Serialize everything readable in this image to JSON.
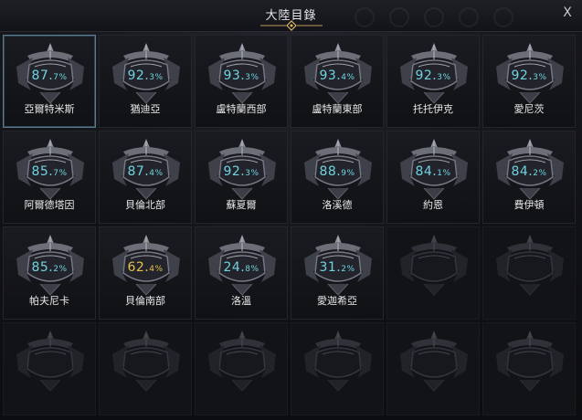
{
  "window": {
    "title": "大陸目錄",
    "close_label": "X"
  },
  "regions": [
    {
      "name": "亞爾特米斯",
      "pct": "87.",
      "dec": "7%",
      "active": true,
      "color": "cyan"
    },
    {
      "name": "猶迪亞",
      "pct": "92.",
      "dec": "3%",
      "active": false,
      "color": "cyan"
    },
    {
      "name": "盧特蘭西部",
      "pct": "93.",
      "dec": "3%",
      "active": false,
      "color": "cyan"
    },
    {
      "name": "盧特蘭東部",
      "pct": "93.",
      "dec": "4%",
      "active": false,
      "color": "cyan"
    },
    {
      "name": "托托伊克",
      "pct": "92.",
      "dec": "3%",
      "active": false,
      "color": "cyan"
    },
    {
      "name": "愛尼茨",
      "pct": "92.",
      "dec": "3%",
      "active": false,
      "color": "cyan"
    },
    {
      "name": "阿爾德塔因",
      "pct": "85.",
      "dec": "7%",
      "active": false,
      "color": "cyan"
    },
    {
      "name": "貝倫北部",
      "pct": "87.",
      "dec": "4%",
      "active": false,
      "color": "cyan"
    },
    {
      "name": "蘇夏爾",
      "pct": "92.",
      "dec": "3%",
      "active": false,
      "color": "cyan"
    },
    {
      "name": "洛溪德",
      "pct": "88.",
      "dec": "9%",
      "active": false,
      "color": "cyan"
    },
    {
      "name": "約恩",
      "pct": "84.",
      "dec": "1%",
      "active": false,
      "color": "cyan"
    },
    {
      "name": "費伊頓",
      "pct": "84.",
      "dec": "2%",
      "active": false,
      "color": "cyan"
    },
    {
      "name": "帕夫尼卡",
      "pct": "85.",
      "dec": "2%",
      "active": false,
      "color": "cyan"
    },
    {
      "name": "貝倫南部",
      "pct": "62.",
      "dec": "4%",
      "active": false,
      "color": "yellow"
    },
    {
      "name": "洛溫",
      "pct": "24.",
      "dec": "8%",
      "active": false,
      "color": "cyan"
    },
    {
      "name": "愛迦希亞",
      "pct": "31.",
      "dec": "2%",
      "active": false,
      "color": "cyan"
    }
  ],
  "colors": {
    "cyan": "#6fd3e1",
    "yellow": "#e6c24b",
    "active_border": "#5d7b8f"
  }
}
